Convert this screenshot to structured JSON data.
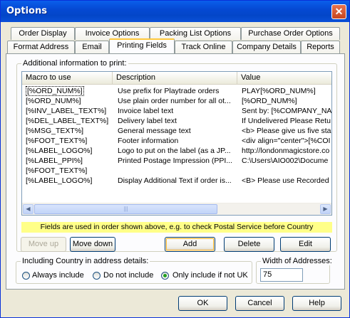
{
  "window": {
    "title": "Options",
    "close_label": "✕"
  },
  "tabs_row1": [
    "Order Display",
    "Invoice Options",
    "Packing List Options",
    "Purchase Order Options"
  ],
  "tabs_row2": [
    "Format Address",
    "Email",
    "Printing Fields",
    "Track Online",
    "Company Details",
    "Reports"
  ],
  "active_tab": "Printing Fields",
  "group_additional": {
    "label": "Additional information to print:"
  },
  "list": {
    "columns": [
      "Macro to use",
      "Description",
      "Value"
    ],
    "rows": [
      [
        "[%ORD_NUM%]",
        "Use prefix for Playtrade orders",
        "PLAY[%ORD_NUM%]"
      ],
      [
        "[%ORD_NUM%]",
        "Use plain order number for all ot...",
        "[%ORD_NUM%]"
      ],
      [
        "[%INV_LABEL_TEXT%]",
        "Invoice label text",
        "Sent by: [%COMPANY_NA"
      ],
      [
        "[%DEL_LABEL_TEXT%]",
        "Delivery label text",
        "If Undelivered Please Retu"
      ],
      [
        "[%MSG_TEXT%]",
        "General message text",
        "<b> Please give us five sta"
      ],
      [
        "[%FOOT_TEXT%]",
        "Footer information",
        "<div align=\"center\">[%COI"
      ],
      [
        "[%LABEL_LOGO%]",
        "Logo to put on the label (as a JP...",
        "http://londonmagicstore.co"
      ],
      [
        "[%LABEL_PPI%]",
        "Printed Postage Impression (PPI...",
        "C:\\Users\\AIO002\\Docume"
      ],
      [
        "[%FOOT_TEXT%]",
        "",
        ""
      ],
      [
        "[%LABEL_LOGO%]",
        "Display Additional Text if order is...",
        "<B> Please use Recorded"
      ]
    ],
    "scroll_left": "◀",
    "scroll_right": "▶",
    "scroll_grip": "|||"
  },
  "note": "Fields are used in order shown above, e.g. to check Postal Service before Country",
  "buttons": {
    "move_up": "Move up",
    "move_down": "Move down",
    "add": "Add",
    "delete": "Delete",
    "edit": "Edit"
  },
  "country_group": {
    "label": "Including Country in address details:",
    "options": [
      "Always include",
      "Do not include",
      "Only include if not UK"
    ],
    "selected": "Only include if not UK"
  },
  "width_group": {
    "label": "Width of Addresses:",
    "value": "75"
  },
  "footer": {
    "ok": "OK",
    "cancel": "Cancel",
    "help": "Help"
  }
}
